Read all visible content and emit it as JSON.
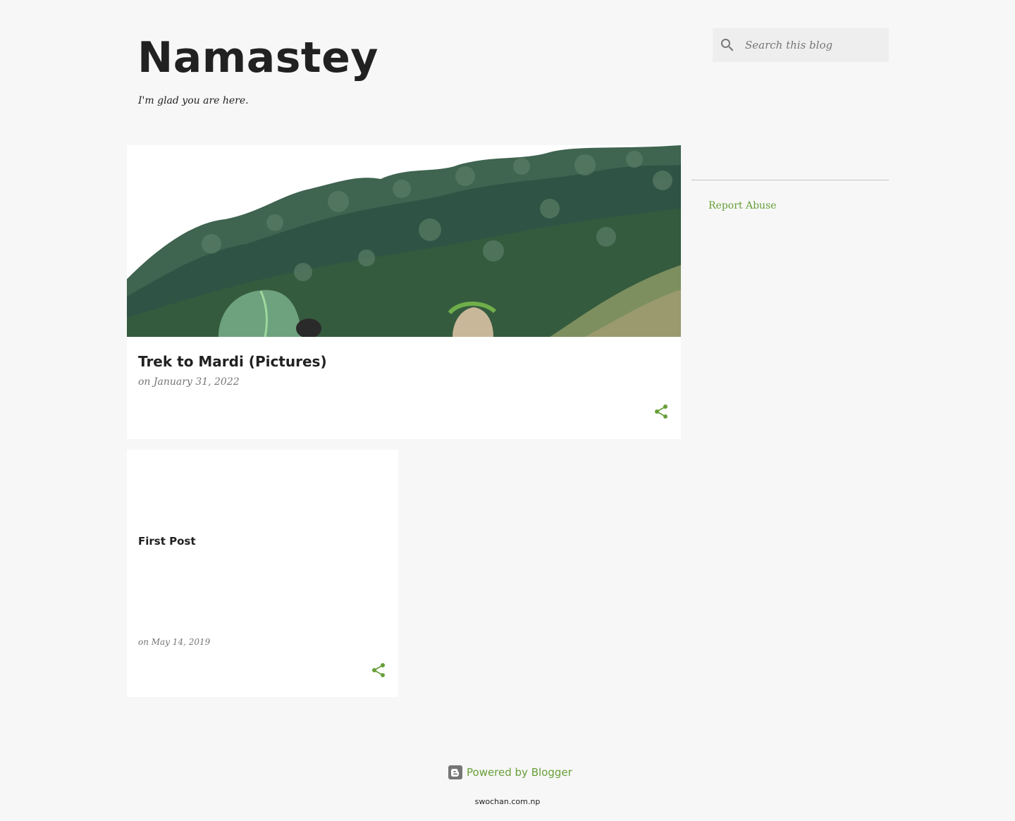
{
  "header": {
    "title": "Namastey",
    "description": "I'm glad you are here."
  },
  "search": {
    "placeholder": "Search this blog",
    "icon": "search-icon"
  },
  "posts": [
    {
      "title": "Trek to Mardi (Pictures)",
      "date": "on January 31, 2022",
      "share_icon": "share-icon",
      "has_image": true
    },
    {
      "title": "First Post",
      "date": "on May 14, 2019",
      "share_icon": "share-icon",
      "has_image": false
    }
  ],
  "sidebar": {
    "report_abuse": "Report Abuse"
  },
  "footer": {
    "powered_by": "Powered by Blogger",
    "domain": "swochan.com.np",
    "icon": "blogger-icon"
  },
  "colors": {
    "background": "#f7f7f7",
    "card": "#ffffff",
    "accent": "#689f38",
    "text": "#212121",
    "muted": "#757575"
  }
}
